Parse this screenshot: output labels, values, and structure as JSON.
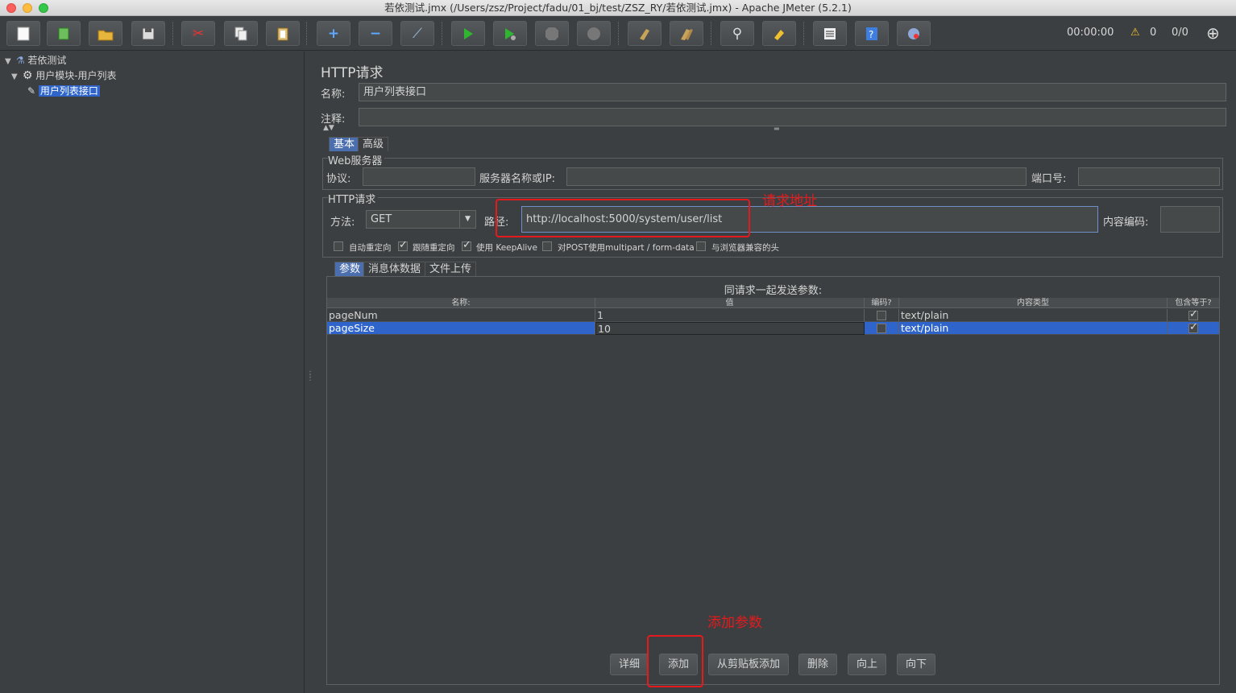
{
  "window": {
    "title": "若依测试.jmx (/Users/zsz/Project/fadu/01_bj/test/ZSZ_RY/若依测试.jmx) - Apache JMeter (5.2.1)"
  },
  "toolbar": {
    "buttons": [
      "new-icon",
      "templates-icon",
      "open-icon",
      "save-icon",
      "cut-icon",
      "copy-icon",
      "paste-icon",
      "expand-icon",
      "collapse-icon",
      "toggle-icon",
      "start-icon",
      "start-no-pause-icon",
      "stop-icon",
      "shutdown-icon",
      "clear-icon",
      "clear-all-icon",
      "search-icon",
      "reset-search-icon",
      "function-helper-icon",
      "help-icon",
      "remote-icon"
    ],
    "timer": "00:00:00",
    "warnings": "0",
    "threads": "0/0"
  },
  "tree": {
    "root": "若依测试",
    "thread_group": "用户模块-用户列表",
    "sampler": "用户列表接口"
  },
  "sampler": {
    "title": "HTTP请求",
    "name_label": "名称:",
    "name_value": "用户列表接口",
    "comment_label": "注释:",
    "comment_value": "",
    "tabs": [
      "基本",
      "高级"
    ],
    "web_server": {
      "title": "Web服务器",
      "protocol_label": "协议:",
      "protocol_value": "",
      "server_label": "服务器名称或IP:",
      "server_value": "",
      "port_label": "端口号:",
      "port_value": ""
    },
    "http_request": {
      "title": "HTTP请求",
      "method_label": "方法:",
      "method_value": "GET",
      "path_label": "路径:",
      "path_value": "http://localhost:5000/system/user/list",
      "encoding_label": "内容编码:",
      "encoding_value": ""
    },
    "options": [
      {
        "label": "自动重定向",
        "checked": false
      },
      {
        "label": "跟随重定向",
        "checked": true
      },
      {
        "label": "使用 KeepAlive",
        "checked": true
      },
      {
        "label": "对POST使用multipart / form-data",
        "checked": false
      },
      {
        "label": "与浏览器兼容的头",
        "checked": false
      }
    ],
    "param_tabs": [
      "参数",
      "消息体数据",
      "文件上传"
    ],
    "params": {
      "caption": "同请求一起发送参数:",
      "headers": [
        "名称:",
        "值",
        "编码?",
        "内容类型",
        "包含等于?"
      ],
      "rows": [
        {
          "name": "pageNum",
          "value": "1",
          "encode": false,
          "content_type": "text/plain",
          "include_equals": true
        },
        {
          "name": "pageSize",
          "value": "10",
          "encode": false,
          "content_type": "text/plain",
          "include_equals": true
        }
      ]
    },
    "buttons": [
      "详细",
      "添加",
      "从剪贴板添加",
      "删除",
      "向上",
      "向下"
    ]
  },
  "annotations": {
    "path_note": "请求地址",
    "add_note": "添加参数",
    "color": "#e41a1c"
  }
}
